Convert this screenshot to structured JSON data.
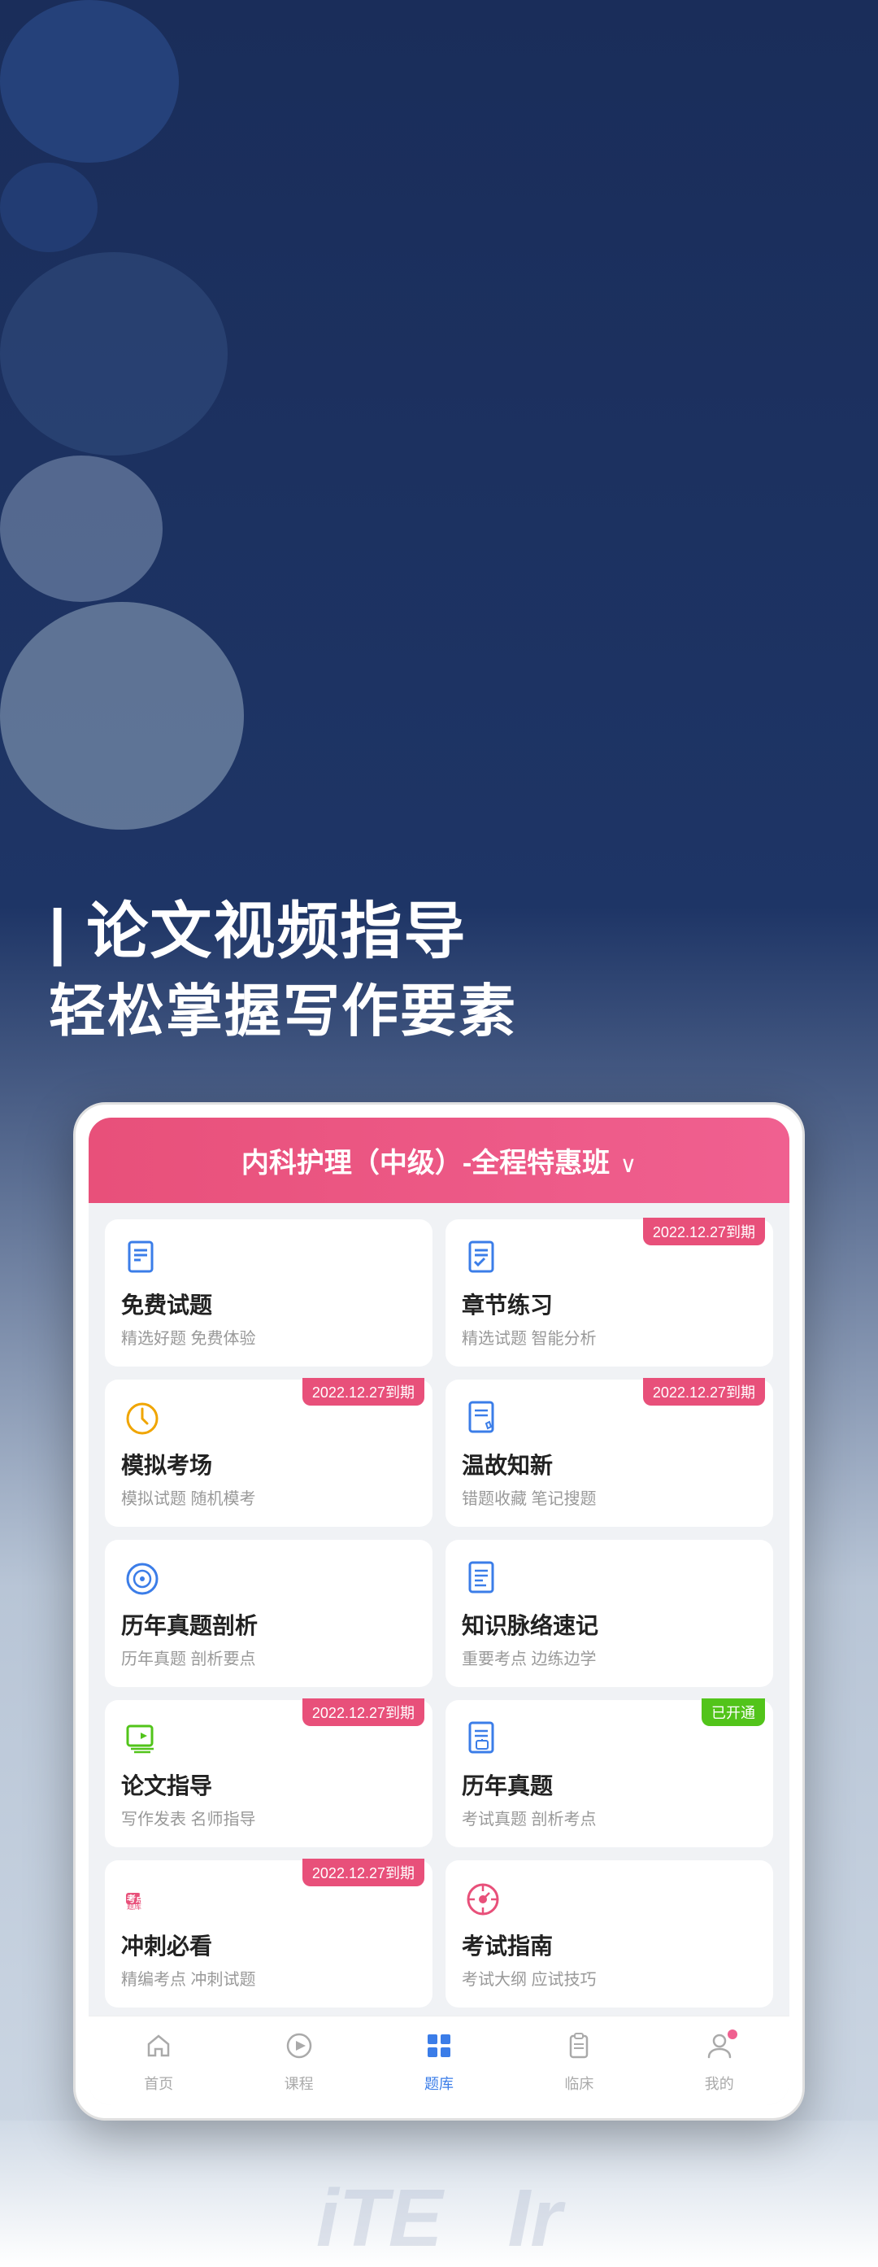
{
  "background": {
    "color_top": "#1a2d5a",
    "color_bottom": "#d0dae6"
  },
  "header": {
    "line1": "| 论文视频指导",
    "line2": "轻松掌握写作要素"
  },
  "app": {
    "course_title": "内科护理（中级）-全程特惠班",
    "cards": [
      {
        "id": "free-questions",
        "title": "免费试题",
        "subtitle": "精选好题 免费体验",
        "badge": null,
        "icon_type": "document-list",
        "icon_color": "#3b7de8"
      },
      {
        "id": "chapter-practice",
        "title": "章节练习",
        "subtitle": "精选试题 智能分析",
        "badge": "2022.12.27到期",
        "icon_type": "document-check",
        "icon_color": "#3b7de8"
      },
      {
        "id": "mock-exam",
        "title": "模拟考场",
        "subtitle": "模拟试题 随机模考",
        "badge": "2022.12.27到期",
        "icon_type": "clock",
        "icon_color": "#f0a500"
      },
      {
        "id": "review",
        "title": "温故知新",
        "subtitle": "错题收藏 笔记搜题",
        "badge": "2022.12.27到期",
        "icon_type": "document-pencil",
        "icon_color": "#3b7de8"
      },
      {
        "id": "past-papers-analysis",
        "title": "历年真题剖析",
        "subtitle": "历年真题 剖析要点",
        "badge": null,
        "icon_type": "target",
        "icon_color": "#3b7de8"
      },
      {
        "id": "knowledge-map",
        "title": "知识脉络速记",
        "subtitle": "重要考点 边练边学",
        "badge": null,
        "icon_type": "document-lines",
        "icon_color": "#3b7de8"
      },
      {
        "id": "thesis-guide",
        "title": "论文指导",
        "subtitle": "写作发表 名师指导",
        "badge": "2022.12.27到期",
        "icon_type": "video-doc",
        "icon_color": "#52c41a"
      },
      {
        "id": "past-papers",
        "title": "历年真题",
        "subtitle": "考试真题 剖析考点",
        "badge": "已开通",
        "badge_color": "green",
        "icon_type": "document-lock",
        "icon_color": "#3b7de8"
      },
      {
        "id": "sprint",
        "title": "冲刺必看",
        "subtitle": "精编考点 冲刺试题",
        "badge": "2022.12.27到期",
        "icon_type": "keypoint",
        "icon_color": "#e8507a"
      },
      {
        "id": "exam-guide",
        "title": "考试指南",
        "subtitle": "考试大纲 应试技巧",
        "badge": null,
        "icon_type": "compass",
        "icon_color": "#e8507a"
      }
    ],
    "nav": [
      {
        "id": "home",
        "label": "首页",
        "icon": "home",
        "active": false
      },
      {
        "id": "course",
        "label": "课程",
        "icon": "play-circle",
        "active": false
      },
      {
        "id": "questions",
        "label": "题库",
        "icon": "grid",
        "active": true
      },
      {
        "id": "clinical",
        "label": "临床",
        "icon": "clipboard",
        "active": false
      },
      {
        "id": "mine",
        "label": "我的",
        "icon": "person",
        "active": false,
        "has_badge": true
      }
    ]
  },
  "bottom_decorative": {
    "text1": "iTE",
    "text2": "Ir"
  }
}
